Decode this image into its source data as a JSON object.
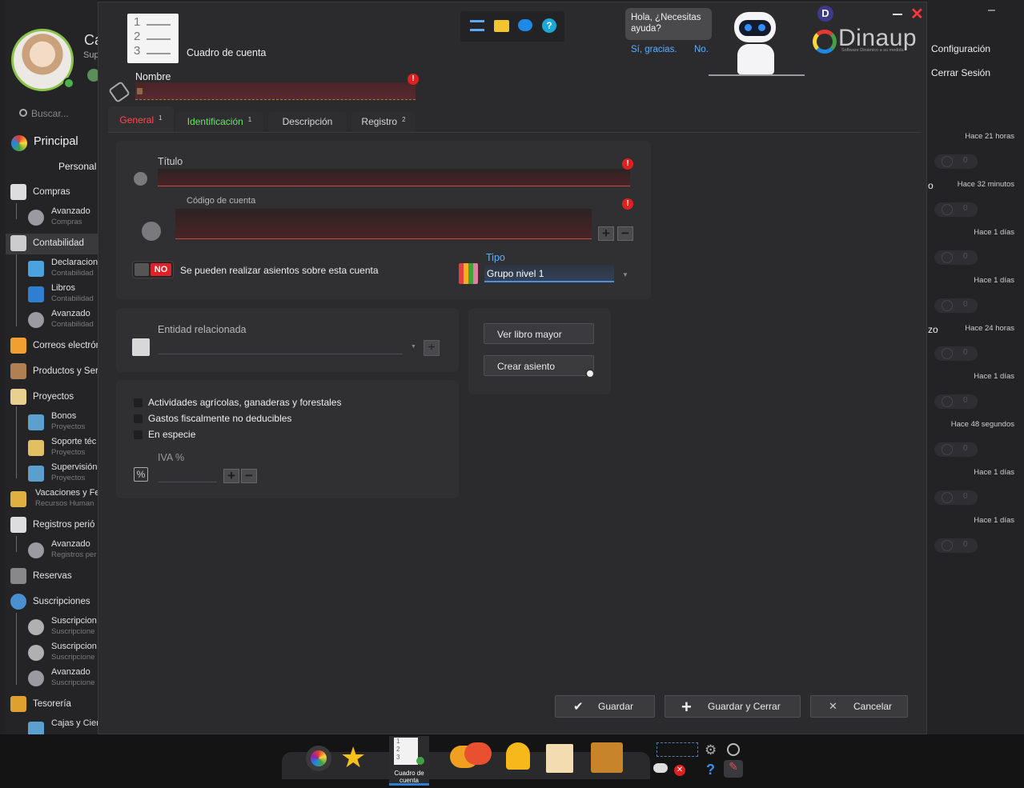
{
  "sidebar": {
    "user_initial": "Ca",
    "user_sub": "Sup",
    "search_placeholder": "Buscar...",
    "principal": "Principal",
    "personal": "Personal",
    "items": [
      {
        "label": "Compras"
      },
      {
        "label": "Avanzado",
        "sub": "Compras"
      },
      {
        "label": "Contabilidad"
      },
      {
        "label": "Declaracion",
        "sub": "Contabilidad"
      },
      {
        "label": "Libros",
        "sub": "Contabilidad"
      },
      {
        "label": "Avanzado",
        "sub": "Contabilidad"
      },
      {
        "label": "Correos electrón"
      },
      {
        "label": "Productos y Serv"
      },
      {
        "label": "Proyectos"
      },
      {
        "label": "Bonos",
        "sub": "Proyectos"
      },
      {
        "label": "Soporte téc",
        "sub": "Proyectos"
      },
      {
        "label": "Supervisión",
        "sub": "Proyectos"
      },
      {
        "label": "Vacaciones y Fe",
        "sub": "Recursos Human"
      },
      {
        "label": "Registros perió"
      },
      {
        "label": "Avanzado",
        "sub": "Registros per"
      },
      {
        "label": "Reservas"
      },
      {
        "label": "Suscripciones"
      },
      {
        "label": "Suscripcion",
        "sub": "Suscripcione"
      },
      {
        "label": "Suscripcion",
        "sub": "Suscripcione"
      },
      {
        "label": "Avanzado",
        "sub": "Suscripcione"
      },
      {
        "label": "Tesorería"
      },
      {
        "label": "Cajas y Cier"
      }
    ]
  },
  "right_panel": {
    "config": "Configuración",
    "logout": "Cerrar Sesión",
    "minimize": "–",
    "notifications": [
      {
        "time": "Hace 21 horas",
        "count": "0",
        "prefix": ""
      },
      {
        "time": "Hace 32 minutos",
        "count": "0",
        "prefix": "o"
      },
      {
        "time": "Hace 1 días",
        "count": "0",
        "prefix": ""
      },
      {
        "time": "Hace 1 días",
        "count": "0",
        "prefix": ""
      },
      {
        "time": "Hace 24 horas",
        "count": "0",
        "prefix": "zo"
      },
      {
        "time": "Hace 1 días",
        "count": "0",
        "prefix": ""
      },
      {
        "time": "Hace 48 segundos",
        "count": "0",
        "prefix": ""
      },
      {
        "time": "Hace 1 días",
        "count": "0",
        "prefix": ""
      },
      {
        "time": "Hace 1 días",
        "count": "0",
        "prefix": ""
      }
    ]
  },
  "modal": {
    "icon_numbers": [
      "1",
      "2",
      "3"
    ],
    "title": "Cuadro de cuenta",
    "name_label": "Nombre",
    "assistant": {
      "greeting": "Hola, ¿Necesitas ayuda?",
      "yes": "Sí, gracias.",
      "no": "No."
    },
    "brand": "Dinaup",
    "brand_tagline": "Software Dinámico a su medida",
    "user_badge": "D",
    "tabs": [
      {
        "label": "General",
        "badge": "1"
      },
      {
        "label": "Identificación",
        "badge": "1"
      },
      {
        "label": "Descripción",
        "badge": ""
      },
      {
        "label": "Registro",
        "badge": "2"
      }
    ],
    "fields": {
      "title_label": "Título",
      "code_label": "Código de cuenta",
      "toggle_state": "NO",
      "toggle_label": "Se pueden realizar asientos sobre esta cuenta",
      "type_label": "Tipo",
      "type_value": "Grupo nivel 1",
      "entity_label": "Entidad relacionada",
      "checkbox_1": "Actividades agrícolas, ganaderas y forestales",
      "checkbox_2": "Gastos fiscalmente no deducibles",
      "checkbox_3": "En especie",
      "vat_label": "IVA %"
    },
    "actions": {
      "ledger": "Ver libro mayor",
      "entry": "Crear asiento",
      "save": "Guardar",
      "save_close": "Guardar y Cerrar",
      "cancel": "Cancelar"
    }
  },
  "taskbar": {
    "active_label": "Cuadro de cuenta",
    "active_numbers": [
      "1",
      "2",
      "3"
    ]
  },
  "colors": {
    "accent_red": "#e02020",
    "tab_active": "#ff4a4a",
    "tab_green": "#6ee06e",
    "link_blue": "#5ab0ff"
  }
}
